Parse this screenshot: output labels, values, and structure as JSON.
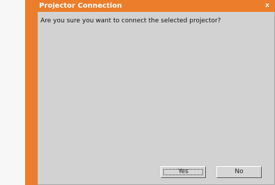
{
  "dialog": {
    "title": "Projector Connection",
    "close_label": "x",
    "message": "Are you sure you want to connect the selected projector?",
    "yes_label": "Yes",
    "no_label": "No",
    "accent_color": "#ec7d2a",
    "background_color": "#d2d2d2"
  }
}
